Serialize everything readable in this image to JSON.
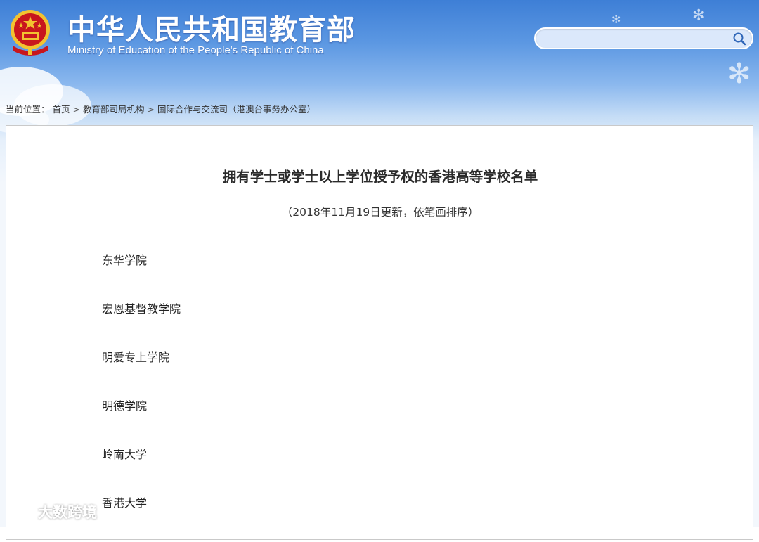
{
  "header": {
    "title": "中华人民共和国教育部",
    "subtitle": "Ministry of Education of the People's Republic of China",
    "emblem_icon": "national-emblem-icon"
  },
  "search": {
    "value": "",
    "placeholder": "",
    "icon": "search-icon"
  },
  "breadcrumb": {
    "label": "当前位置：",
    "items": [
      "首页",
      "教育部司局机构",
      "国际合作与交流司（港澳台事务办公室）"
    ],
    "separator": ">"
  },
  "article": {
    "title": "拥有学士或学士以上学位授予权的香港高等学校名单",
    "note": "（2018年11月19日更新，依笔画排序）",
    "schools": [
      "东华学院",
      "宏恩基督教学院",
      "明爱专上学院",
      "明德学院",
      "岭南大学",
      "香港大学"
    ]
  },
  "watermark": {
    "text": "大数跨境"
  },
  "colors": {
    "header_blue": "#3e7fd6",
    "emblem_red": "#c8161d",
    "emblem_gold": "#f2c230",
    "text_dark": "#2b2b2b"
  }
}
